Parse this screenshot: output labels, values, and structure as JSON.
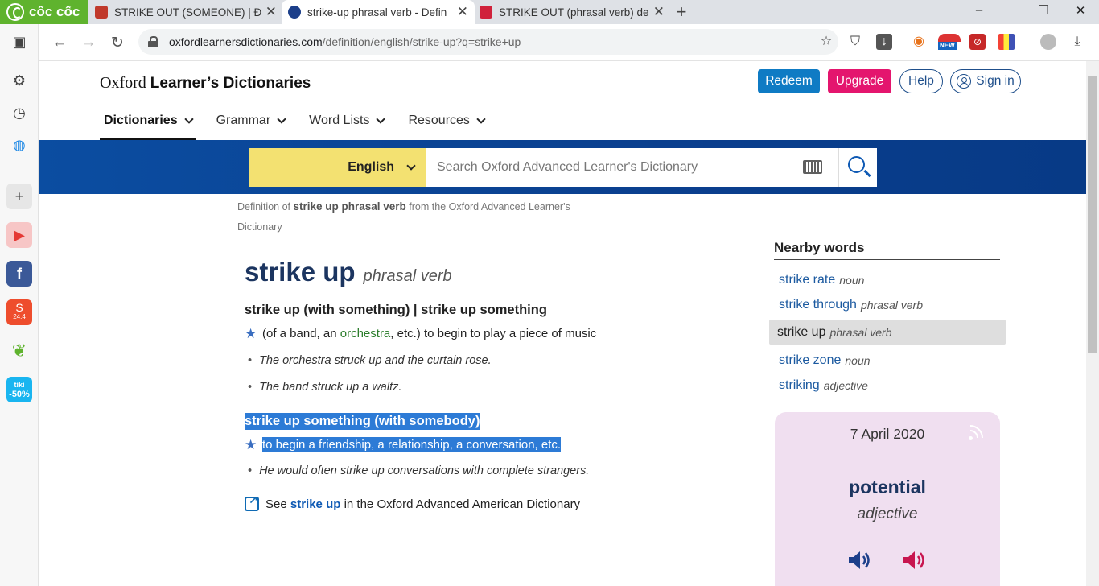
{
  "browser": {
    "brand": "cốc cốc",
    "tabs": [
      {
        "title": "STRIKE OUT (SOMEONE) | Định",
        "active": false
      },
      {
        "title": "strike-up phrasal verb - Defin",
        "active": true
      },
      {
        "title": "STRIKE OUT (phrasal verb) de",
        "active": false
      }
    ],
    "url_domain": "oxfordlearnersdictionaries.com",
    "url_path": "/definition/english/strike-up?q=strike+up",
    "new_badge": "NEW",
    "sidebar_badge": "24.4",
    "tiki_label": "tiki",
    "tiki_discount": "-50%"
  },
  "site": {
    "logo_oxford": "Oxford",
    "logo_rest": "Learner’s Dictionaries",
    "redeem": "Redeem",
    "upgrade": "Upgrade",
    "help": "Help",
    "signin": "Sign in",
    "nav": [
      "Dictionaries",
      "Grammar",
      "Word Lists",
      "Resources"
    ],
    "language": "English",
    "search_placeholder": "Search Oxford Advanced Learner's Dictionary"
  },
  "colors": {
    "accent_blue": "#0b4da1",
    "redeem": "#0f7bc4",
    "upgrade": "#e4156e",
    "language_bg": "#f3e171",
    "wotd_bg": "#f0dff0",
    "selection": "#2d7bd6"
  },
  "entry": {
    "crumb_prefix": "Definition of",
    "crumb_term": "strike up phrasal verb",
    "crumb_suffix": "from the Oxford Advanced Learner's Dictionary",
    "headword": "strike up",
    "pos": "phrasal verb",
    "senses": [
      {
        "heading": "strike up (with something) | strike up something",
        "def_before": "(of a band, an",
        "def_link": "orchestra",
        "def_after": ", etc.) to begin to play a piece of music",
        "examples": [
          "The orchestra struck up and the curtain rose.",
          "The band struck up a waltz."
        ]
      },
      {
        "heading": "strike up something (with somebody)",
        "def": "to begin a friendship, a relationship, a conversation, etc.",
        "examples": [
          "He would often strike up conversations with complete strangers."
        ]
      }
    ],
    "see_prefix": "See",
    "see_link": "strike up",
    "see_suffix": "in the Oxford Advanced American Dictionary"
  },
  "nearby": {
    "title": "Nearby words",
    "items": [
      {
        "word": "strike rate",
        "pos": "noun"
      },
      {
        "word": "strike through",
        "pos": "phrasal verb"
      },
      {
        "word": "strike up",
        "pos": "phrasal verb",
        "current": true
      },
      {
        "word": "strike zone",
        "pos": "noun"
      },
      {
        "word": "striking",
        "pos": "adjective"
      }
    ]
  },
  "wotd": {
    "date": "7 April 2020",
    "word": "potential",
    "pos": "adjective"
  }
}
